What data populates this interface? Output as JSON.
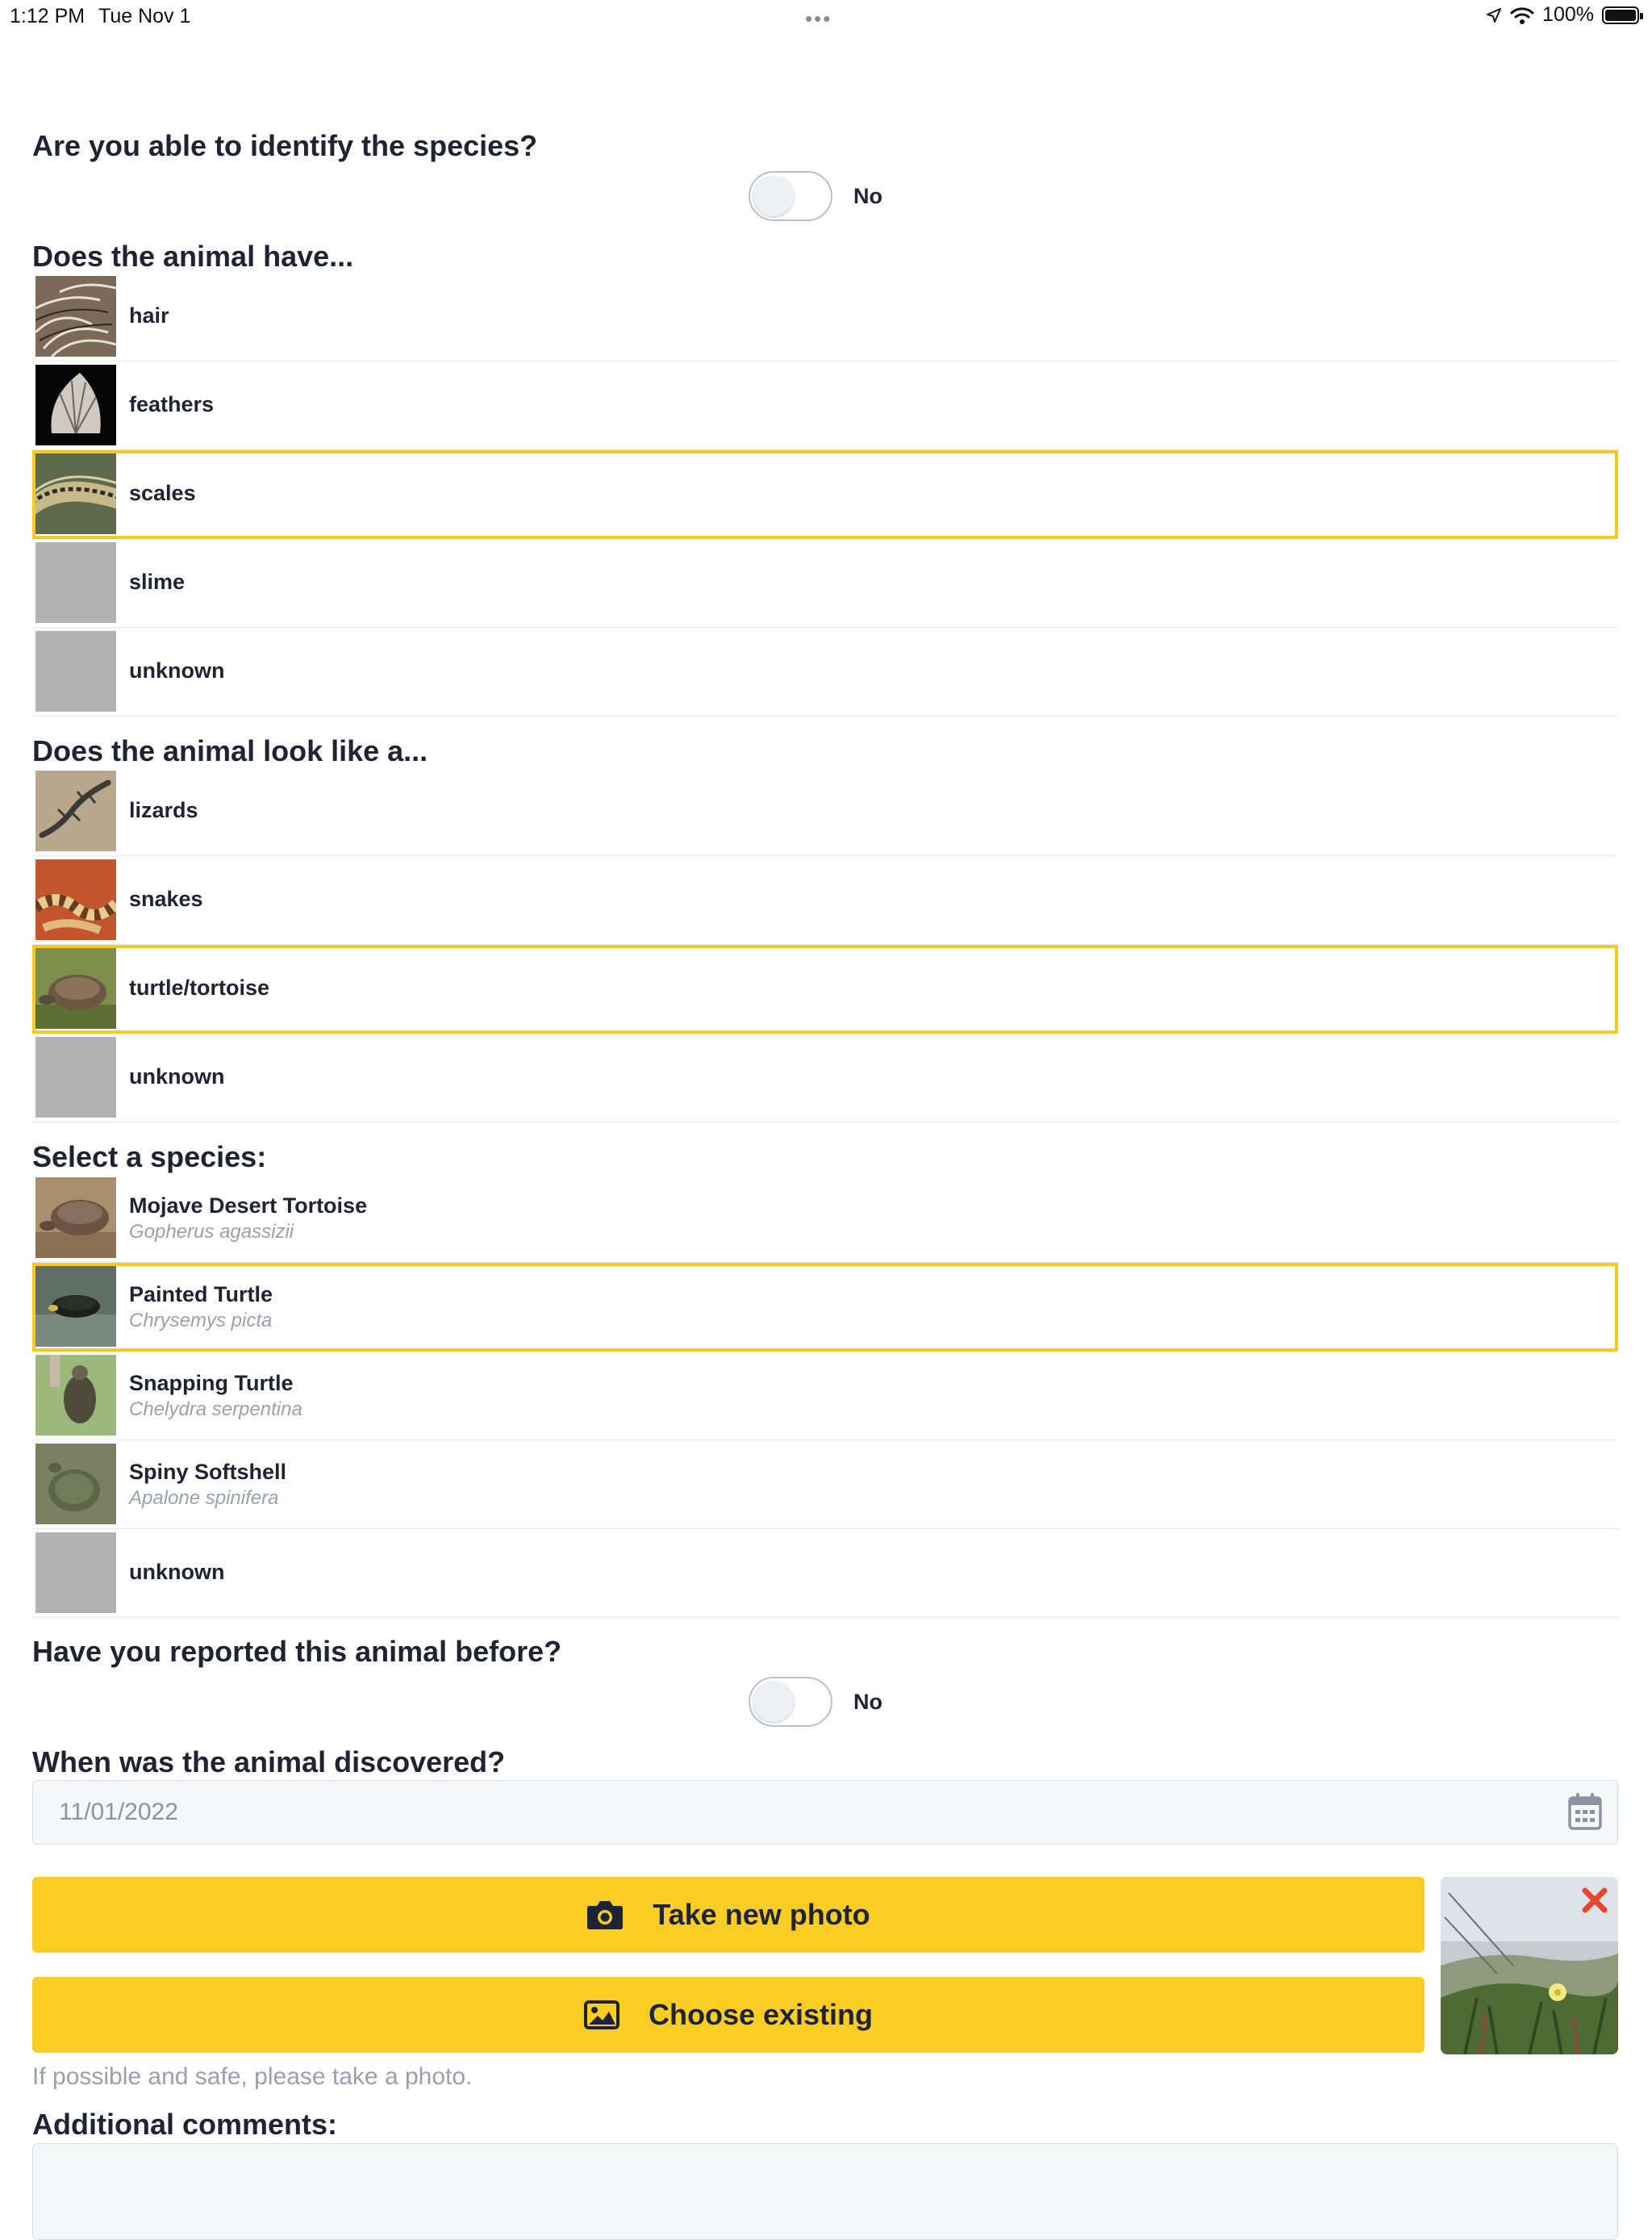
{
  "status_bar": {
    "time": "1:12 PM",
    "date": "Tue Nov 1",
    "battery": "100%"
  },
  "identify": {
    "question": "Are you able to identify the species?",
    "toggle_label": "No"
  },
  "has": {
    "question": "Does the animal have...",
    "items": [
      {
        "label": "hair",
        "selected": false,
        "thumb": "fur-photo"
      },
      {
        "label": "feathers",
        "selected": false,
        "thumb": "feather-photo"
      },
      {
        "label": "scales",
        "selected": true,
        "thumb": "snake-scales-photo"
      },
      {
        "label": "slime",
        "selected": false,
        "thumb": "placeholder"
      },
      {
        "label": "unknown",
        "selected": false,
        "thumb": "placeholder"
      }
    ]
  },
  "looks": {
    "question": "Does the animal look like a...",
    "items": [
      {
        "label": "lizards",
        "selected": false,
        "thumb": "lizard-photo"
      },
      {
        "label": "snakes",
        "selected": false,
        "thumb": "snake-photo"
      },
      {
        "label": "turtle/tortoise",
        "selected": true,
        "thumb": "tortoise-photo"
      },
      {
        "label": "unknown",
        "selected": false,
        "thumb": "placeholder"
      }
    ]
  },
  "species": {
    "question": "Select a species:",
    "items": [
      {
        "name": "Mojave Desert Tortoise",
        "scientific": "Gopherus agassizii",
        "selected": false,
        "thumb": "desert-tortoise-photo"
      },
      {
        "name": "Painted Turtle",
        "scientific": "Chrysemys picta",
        "selected": true,
        "thumb": "painted-turtle-photo"
      },
      {
        "name": "Snapping Turtle",
        "scientific": "Chelydra serpentina",
        "selected": false,
        "thumb": "snapping-turtle-photo"
      },
      {
        "name": "Spiny Softshell",
        "scientific": "Apalone spinifera",
        "selected": false,
        "thumb": "softshell-photo"
      },
      {
        "name": "unknown",
        "scientific": "",
        "selected": false,
        "thumb": "placeholder"
      }
    ]
  },
  "reported": {
    "question": "Have you reported this animal before?",
    "toggle_label": "No"
  },
  "discovered": {
    "question": "When was the animal discovered?",
    "value": "11/01/2022"
  },
  "photo": {
    "take_label": "Take new photo",
    "choose_label": "Choose existing",
    "hint": "If possible and safe, please take a photo."
  },
  "comments": {
    "question": "Additional comments:",
    "value": ""
  },
  "colors": {
    "accent": "#f9cd24",
    "selected_border": "#f8c921",
    "heading": "#1e2433",
    "muted": "#98a0b0"
  }
}
